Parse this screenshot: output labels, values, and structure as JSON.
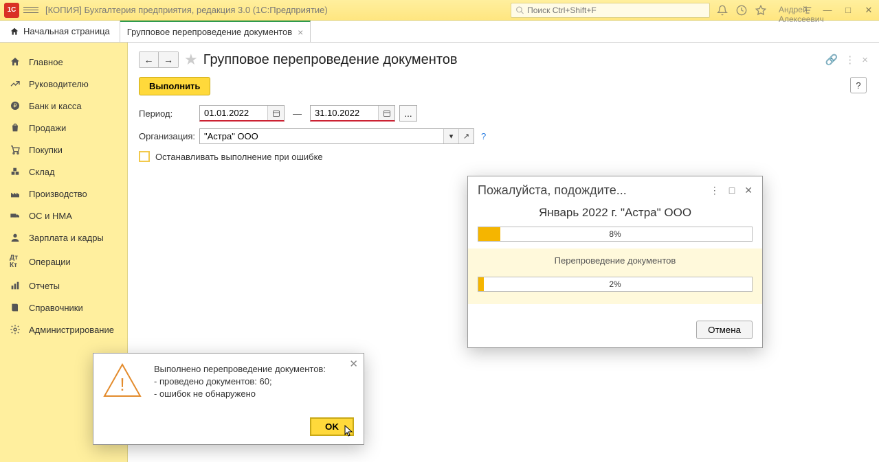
{
  "titlebar": {
    "logo": "1C",
    "title": "[КОПИЯ] Бухгалтерия предприятия, редакция 3.0  (1С:Предприятие)",
    "search_placeholder": "Поиск Ctrl+Shift+F",
    "user": "Андрей Алексеевич"
  },
  "tabs": {
    "home": "Начальная страница",
    "active": "Групповое перепроведение документов"
  },
  "sidebar": {
    "items": [
      "Главное",
      "Руководителю",
      "Банк и касса",
      "Продажи",
      "Покупки",
      "Склад",
      "Производство",
      "ОС и НМА",
      "Зарплата и кадры",
      "Операции",
      "Отчеты",
      "Справочники",
      "Администрирование"
    ]
  },
  "page": {
    "title": "Групповое перепроведение документов",
    "execute": "Выполнить",
    "help": "?",
    "period_label": "Период:",
    "date_from": "01.01.2022",
    "date_to": "31.10.2022",
    "dash": "—",
    "ellipsis": "...",
    "org_label": "Организация:",
    "org_value": "\"Астра\" ООО",
    "checkbox_label": "Останавливать выполнение при ошибке",
    "qmark": "?"
  },
  "progress_dialog": {
    "title": "Пожалуйста, подождите...",
    "subtitle": "Январь 2022 г. \"Астра\" ООО",
    "pct1": "8%",
    "pct1_width": "8%",
    "status": "Перепроведение документов",
    "pct2": "2%",
    "pct2_width": "2%",
    "cancel": "Отмена"
  },
  "msg_dialog": {
    "text": "Выполнено перепроведение документов:\n- проведено документов: 60;\n- ошибок не обнаружено",
    "ok": "OK"
  }
}
